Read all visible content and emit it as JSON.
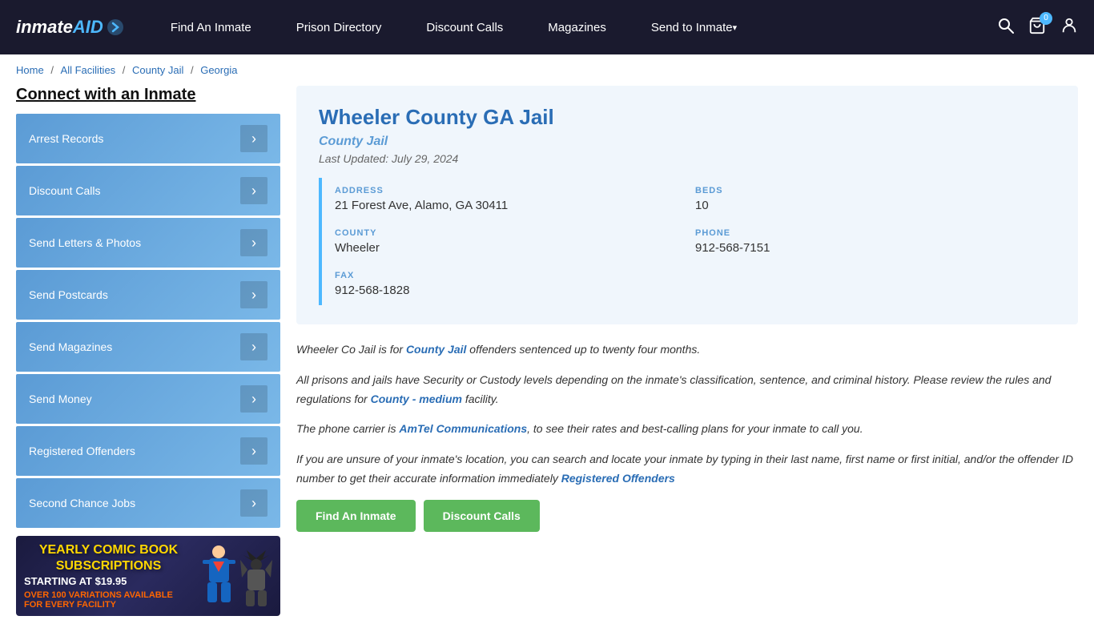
{
  "header": {
    "logo": "inmateAID",
    "logo_part1": "inmate",
    "logo_part2": "AID",
    "nav": [
      {
        "label": "Find An Inmate",
        "id": "find-inmate",
        "arrow": false
      },
      {
        "label": "Prison Directory",
        "id": "prison-directory",
        "arrow": false
      },
      {
        "label": "Discount Calls",
        "id": "discount-calls",
        "arrow": false
      },
      {
        "label": "Magazines",
        "id": "magazines",
        "arrow": false
      },
      {
        "label": "Send to Inmate",
        "id": "send-to-inmate",
        "arrow": true
      }
    ],
    "cart_count": "0"
  },
  "breadcrumb": {
    "home": "Home",
    "all_facilities": "All Facilities",
    "county_jail": "County Jail",
    "state": "Georgia"
  },
  "sidebar": {
    "title": "Connect with an Inmate",
    "buttons": [
      {
        "label": "Arrest Records",
        "id": "arrest-records"
      },
      {
        "label": "Discount Calls",
        "id": "discount-calls-sidebar"
      },
      {
        "label": "Send Letters & Photos",
        "id": "send-letters"
      },
      {
        "label": "Send Postcards",
        "id": "send-postcards"
      },
      {
        "label": "Send Magazines",
        "id": "send-magazines"
      },
      {
        "label": "Send Money",
        "id": "send-money"
      },
      {
        "label": "Registered Offenders",
        "id": "registered-offenders"
      },
      {
        "label": "Second Chance Jobs",
        "id": "second-chance-jobs"
      }
    ],
    "ad": {
      "title": "YEARLY COMIC BOOK\nSUBSCRIPTIONS",
      "subtitle": "OVER 100 VARIATIONS AVAILABLE FOR EVERY FACILITY",
      "price": "STARTING AT $19.95"
    }
  },
  "facility": {
    "title": "Wheeler County GA Jail",
    "type": "County Jail",
    "last_updated": "Last Updated: July 29, 2024",
    "address_label": "ADDRESS",
    "address_value": "21 Forest Ave, Alamo, GA 30411",
    "beds_label": "BEDS",
    "beds_value": "10",
    "county_label": "COUNTY",
    "county_value": "Wheeler",
    "phone_label": "PHONE",
    "phone_value": "912-568-7151",
    "fax_label": "FAX",
    "fax_value": "912-568-1828"
  },
  "descriptions": [
    {
      "text_before": "Wheeler Co Jail is for ",
      "link_text": "County Jail",
      "link_href": "#",
      "text_after": " offenders sentenced up to twenty four months."
    },
    {
      "text_before": "All prisons and jails have Security or Custody levels depending on the inmate's classification, sentence, and criminal history. Please review the rules and regulations for ",
      "link_text": "County - medium",
      "link_href": "#",
      "text_after": " facility."
    },
    {
      "text_before": "The phone carrier is ",
      "link_text": "AmTel Communications",
      "link_href": "#",
      "text_after": ", to see their rates and best-calling plans for your inmate to call you."
    },
    {
      "text_before": "If you are unsure of your inmate's location, you can search and locate your inmate by typing in their last name, first name or first initial, and/or the offender ID number to get their accurate information immediately ",
      "link_text": "Registered Offenders",
      "link_href": "#",
      "text_after": ""
    }
  ],
  "action_buttons": [
    {
      "label": "Find An Inmate",
      "id": "find-btn"
    },
    {
      "label": "Discount Calls",
      "id": "discount-btn"
    }
  ]
}
